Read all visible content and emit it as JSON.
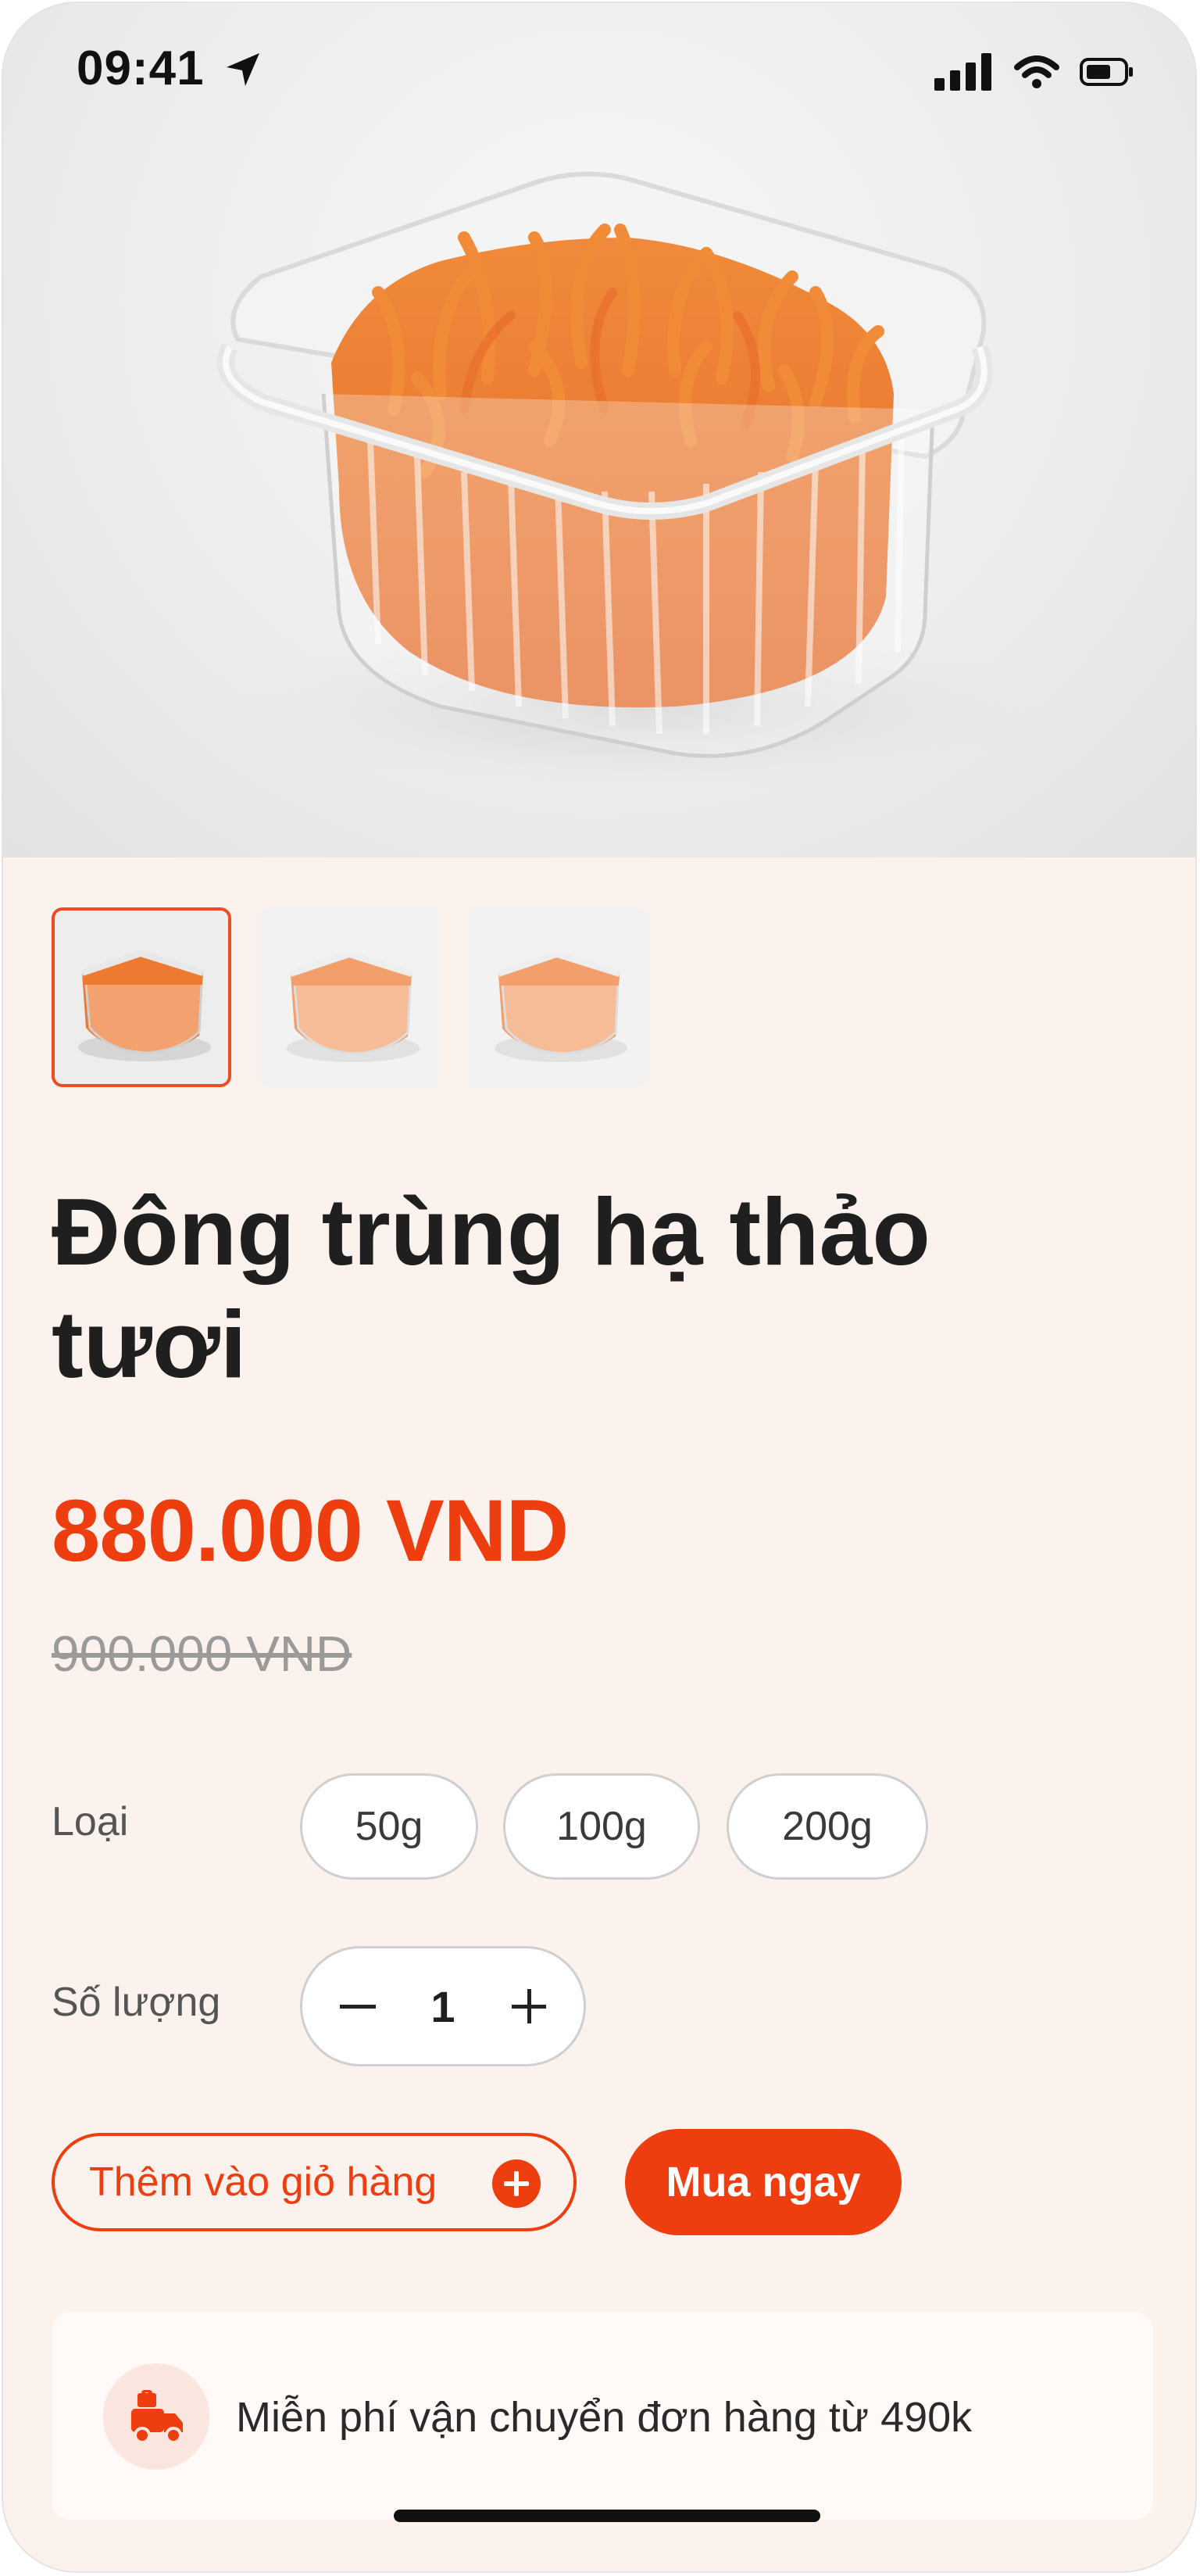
{
  "status_bar": {
    "time": "09:41"
  },
  "product": {
    "title": "Đông trùng hạ thảo tươi",
    "price": "880.000 VND",
    "old_price": "900.000 VND"
  },
  "options": {
    "type_label": "Loại",
    "sizes": [
      "50g",
      "100g",
      "200g"
    ],
    "quantity_label": "Số lượng",
    "quantity": "1"
  },
  "actions": {
    "add_to_cart": "Thêm vào giỏ hàng",
    "buy_now": "Mua ngay"
  },
  "shipping": {
    "text": "Miễn phí vận chuyển đơn hàng từ 490k"
  },
  "colors": {
    "accent": "#ee3e0f",
    "background": "#fbf1ed"
  }
}
